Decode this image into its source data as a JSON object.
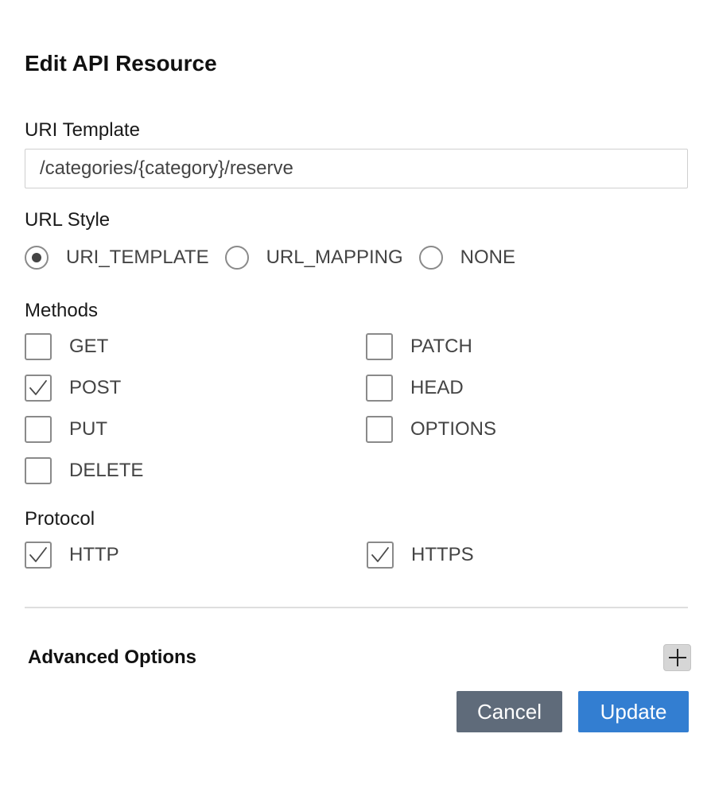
{
  "dialog": {
    "title": "Edit API Resource"
  },
  "uri_template": {
    "label": "URI Template",
    "value": "/categories/{category}/reserve"
  },
  "url_style": {
    "label": "URL Style",
    "options": [
      {
        "label": "URI_TEMPLATE",
        "selected": true
      },
      {
        "label": "URL_MAPPING",
        "selected": false
      },
      {
        "label": "NONE",
        "selected": false
      }
    ]
  },
  "methods": {
    "label": "Methods",
    "items": [
      {
        "label": "GET",
        "checked": false
      },
      {
        "label": "POST",
        "checked": true
      },
      {
        "label": "PUT",
        "checked": false
      },
      {
        "label": "DELETE",
        "checked": false
      },
      {
        "label": "PATCH",
        "checked": false
      },
      {
        "label": "HEAD",
        "checked": false
      },
      {
        "label": "OPTIONS",
        "checked": false
      }
    ]
  },
  "protocol": {
    "label": "Protocol",
    "items": [
      {
        "label": "HTTP",
        "checked": true
      },
      {
        "label": "HTTPS",
        "checked": true
      }
    ]
  },
  "advanced": {
    "label": "Advanced Options",
    "expand_icon": "plus-icon"
  },
  "actions": {
    "cancel_label": "Cancel",
    "update_label": "Update"
  },
  "colors": {
    "cancel_button": "#5f6b7a",
    "update_button": "#337ed1",
    "border": "#8a8a8a"
  }
}
